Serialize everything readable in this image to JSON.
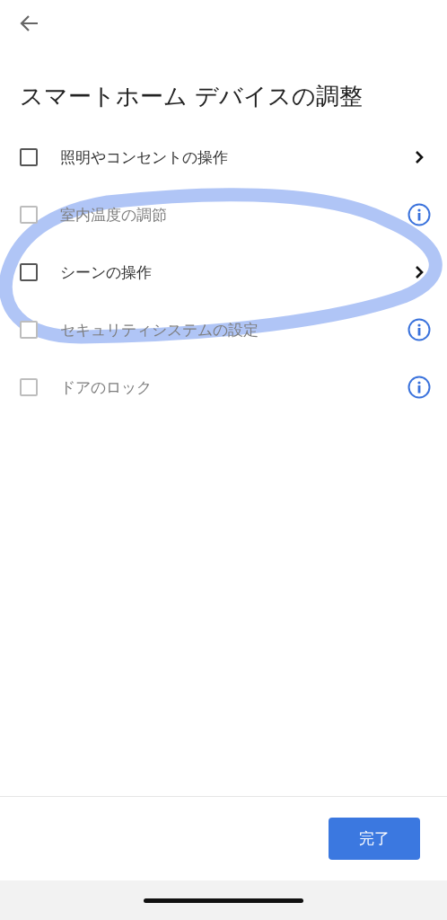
{
  "title": "スマートホーム デバイスの調整",
  "items": [
    {
      "label": "照明やコンセントの操作",
      "checked": false,
      "disabled": false,
      "kind": "chevron"
    },
    {
      "label": "室内温度の調節",
      "checked": false,
      "disabled": true,
      "kind": "info"
    },
    {
      "label": "シーンの操作",
      "checked": false,
      "disabled": false,
      "kind": "chevron"
    },
    {
      "label": "セキュリティシステムの設定",
      "checked": false,
      "disabled": true,
      "kind": "info"
    },
    {
      "label": "ドアのロック",
      "checked": false,
      "disabled": true,
      "kind": "info"
    }
  ],
  "done_button": "完了",
  "annotation": {
    "kind": "ellipse",
    "color": "#3a6ee8"
  }
}
